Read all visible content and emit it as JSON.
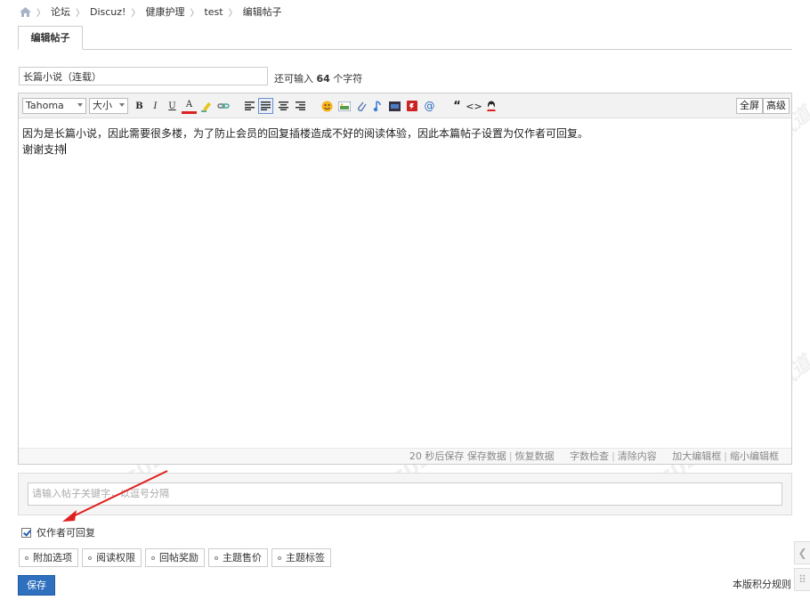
{
  "breadcrumb": {
    "items": [
      "论坛",
      "Discuz!",
      "健康护理",
      "test",
      "编辑帖子"
    ]
  },
  "tabs": [
    {
      "label": "编辑帖子"
    }
  ],
  "subject": {
    "value": "长篇小说（连载）",
    "hint_prefix": "还可输入",
    "hint_count": "64",
    "hint_suffix": "个字符"
  },
  "toolbar": {
    "font_family": "Tahoma",
    "font_size": "大小",
    "fullscreen_label": "全屏",
    "advanced_label": "高级",
    "buttons": [
      "B",
      "I",
      "U",
      "A"
    ]
  },
  "editor": {
    "line1": "因为是长篇小说，因此需要很多楼，为了防止会员的回复插楼造成不好的阅读体验，因此本篇帖子设置为仅作者可回复。",
    "line2": "谢谢支持"
  },
  "statusbar": {
    "autosave": "20 秒后保存",
    "save_data": "保存数据",
    "restore_data": "恢复数据",
    "word_check": "字数检查",
    "clear_content": "清除内容",
    "enlarge": "加大编辑框",
    "shrink": "缩小编辑框"
  },
  "tags": {
    "placeholder": "请输入帖子关键字，以逗号分隔"
  },
  "author_only": {
    "label": "仅作者可回复",
    "checked": true
  },
  "options": [
    {
      "label": "附加选项"
    },
    {
      "label": "阅读权限"
    },
    {
      "label": "回帖奖励"
    },
    {
      "label": "主题售价"
    },
    {
      "label": "主题标签"
    }
  ],
  "save_label": "保存",
  "rules_link": "本版积分规则",
  "watermark": {
    "line1": "DISCUZ!应用中心 | 贰道",
    "line2": "addon.dismall.com"
  },
  "colors": {
    "accent": "#2e6fbe",
    "arrow": "#e02020"
  }
}
